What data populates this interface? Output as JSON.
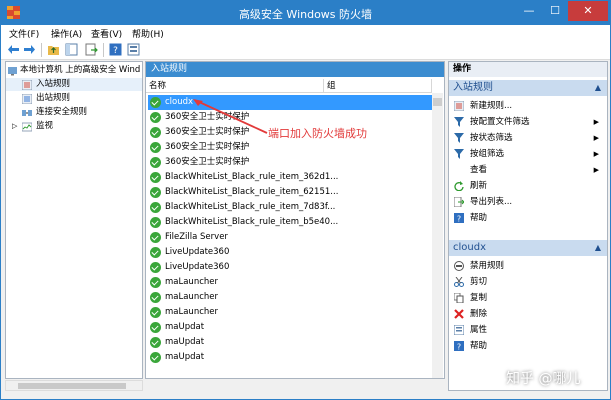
{
  "window": {
    "title": "高级安全 Windows 防火墙",
    "minimize": "—",
    "maximize": "☐",
    "close": "✕"
  },
  "menu": [
    "文件(F)",
    "操作(A)",
    "查看(V)",
    "帮助(H)"
  ],
  "tree": {
    "root": "本地计算机 上的高级安全 Wind",
    "items": [
      "入站规则",
      "出站规则",
      "连接安全规则",
      "监视"
    ]
  },
  "middle": {
    "header": "入站规则",
    "col_name": "名称",
    "col_group": "组",
    "rules": [
      "cloudx",
      "360安全卫士实时保护",
      "360安全卫士实时保护",
      "360安全卫士实时保护",
      "360安全卫士实时保护",
      "BlackWhiteList_Black_rule_item_362d1...",
      "BlackWhiteList_Black_rule_item_62151...",
      "BlackWhiteList_Black_rule_item_7d83f...",
      "BlackWhiteList_Black_rule_item_b5e40...",
      "FileZilla Server",
      "LiveUpdate360",
      "LiveUpdate360",
      "maLauncher",
      "maLauncher",
      "maLauncher",
      "maUpdat",
      "maUpdat",
      "maUpdat"
    ]
  },
  "annotation": "端口加入防火墙成功",
  "actions": {
    "header": "操作",
    "section1": "入站规则",
    "items1": [
      "新建规则...",
      "按配置文件筛选",
      "按状态筛选",
      "按组筛选",
      "查看",
      "刷新",
      "导出列表...",
      "帮助"
    ],
    "section2": "cloudx",
    "items2": [
      "禁用规则",
      "剪切",
      "复制",
      "删除",
      "属性",
      "帮助"
    ],
    "submenu_arrow": "▶",
    "collapse_caret": "▲"
  },
  "watermark": "知乎 @哪儿",
  "colors": {
    "titlebar": "#2b7fc7",
    "selection": "#3399ff",
    "enabled_check": "#3aa63a",
    "annotation": "#e23a3a"
  }
}
